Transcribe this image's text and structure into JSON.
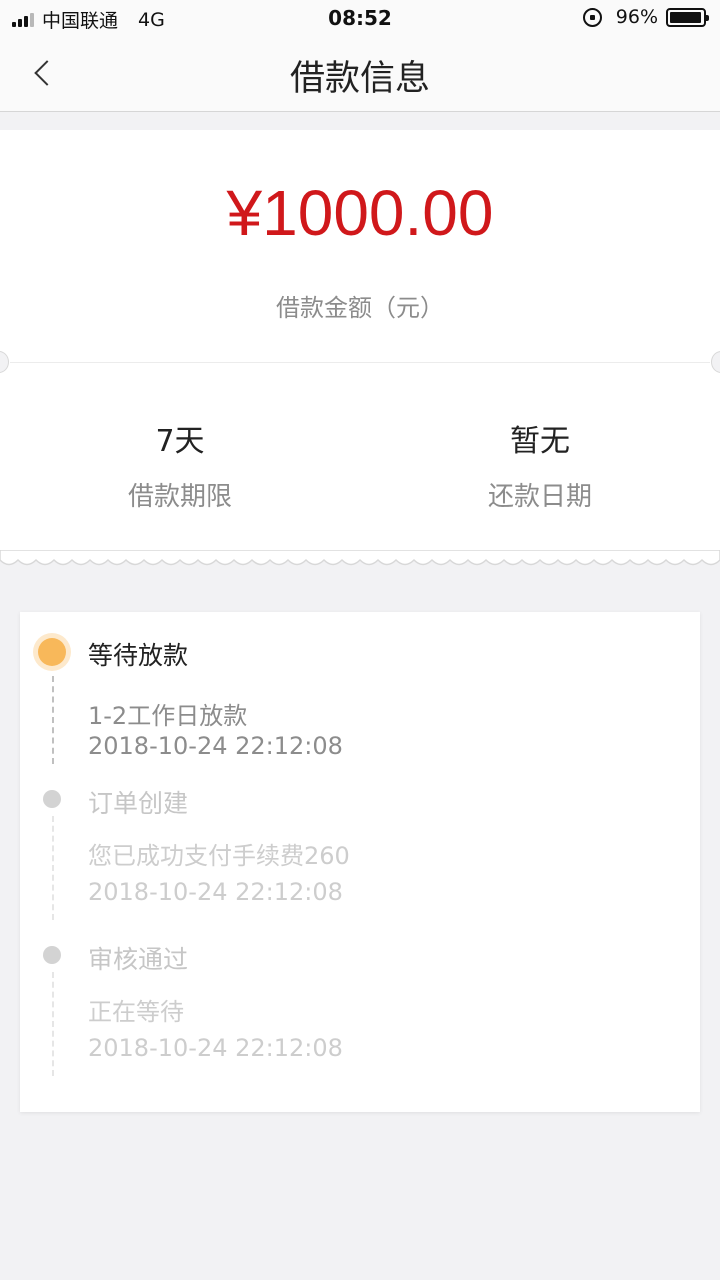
{
  "status_bar": {
    "carrier": "中国联通",
    "network": "4G",
    "time": "08:52",
    "battery": "96%",
    "battery_level": 0.96
  },
  "nav": {
    "title": "借款信息"
  },
  "loan": {
    "amount": "¥1000.00",
    "amount_label": "借款金额（元）",
    "term_value": "7天",
    "term_label": "借款期限",
    "repay_value": "暂无",
    "repay_label": "还款日期"
  },
  "timeline": [
    {
      "title": "等待放款",
      "lines": [
        "1-2工作日放款",
        "2018-10-24 22:12:08"
      ],
      "status": "active"
    },
    {
      "title": "订单创建",
      "lines": [
        "您已成功支付手续费260",
        "2018-10-24 22:12:08"
      ],
      "status": "done"
    },
    {
      "title": "审核通过",
      "lines": [
        "正在等待",
        "2018-10-24 22:12:08"
      ],
      "status": "done"
    }
  ],
  "colors": {
    "amount": "#d0181b",
    "active_dot": "#f8b85a",
    "inactive_dot": "#d3d3d3",
    "background": "#f2f2f4"
  }
}
